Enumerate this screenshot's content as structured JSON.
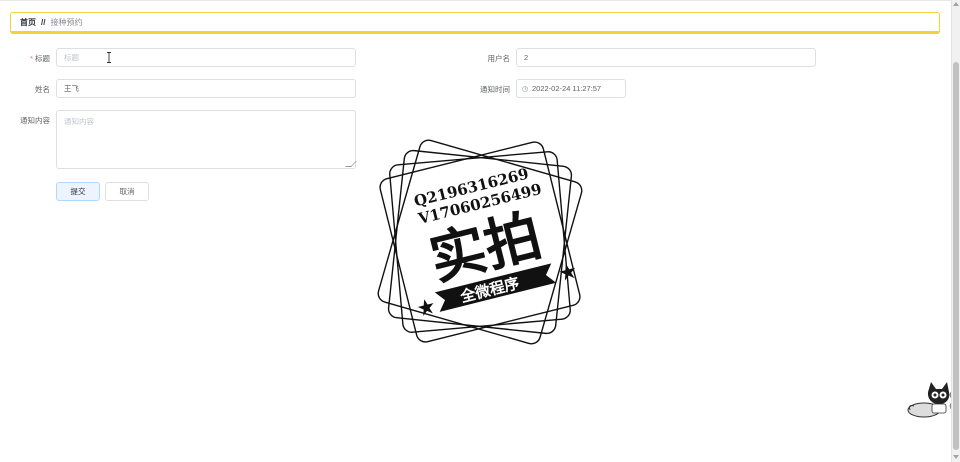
{
  "breadcrumb": {
    "home": "首页",
    "separator": "//",
    "current": "接种预约"
  },
  "form": {
    "title_label": "标题",
    "title_placeholder": "标题",
    "username_label": "用户名",
    "username_value": "2",
    "name_label": "姓名",
    "name_value": "王飞",
    "notify_time_label": "通知时间",
    "notify_time_value": "2022-02-24 11:27:57",
    "content_label": "通知内容",
    "content_placeholder": "通知内容",
    "submit_label": "提交",
    "cancel_label": "取消"
  },
  "watermark": {
    "qq": "Q2196316269",
    "vx": "V17060256499",
    "main": "实拍",
    "banner": "全微程序"
  },
  "icons": {
    "time": "clock-icon",
    "cursor": "text-cursor-icon",
    "mascot": "cat-mascot-icon"
  },
  "colors": {
    "accent": "#f0d23a",
    "required": "#f56c6c"
  }
}
